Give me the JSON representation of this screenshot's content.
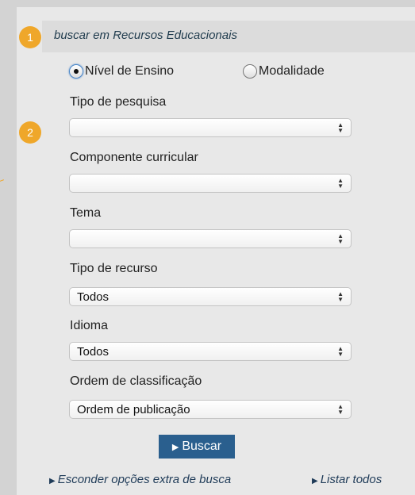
{
  "header": {
    "title": "buscar em Recursos Educacionais"
  },
  "markers": [
    "1",
    "2"
  ],
  "search_mode": {
    "options": [
      {
        "label": "Nível de Ensino",
        "checked": true
      },
      {
        "label": "Modalidade",
        "checked": false
      }
    ]
  },
  "fields": [
    {
      "label": "Tipo de pesquisa",
      "value": ""
    },
    {
      "label": "Componente curricular",
      "value": ""
    },
    {
      "label": "Tema",
      "value": ""
    },
    {
      "label": "Tipo de recurso",
      "value": "Todos"
    },
    {
      "label": "Idioma",
      "value": "Todos"
    },
    {
      "label": "Ordem de classificação",
      "value": "Ordem de publicação"
    }
  ],
  "actions": {
    "search_button": "Buscar",
    "hide_options_link": "Esconder opções extra de busca",
    "list_all_link": "Listar todos"
  },
  "icons": {
    "select_arrows": "updown-chevron-icon",
    "play_triangle": "play-triangle-icon"
  },
  "colors": {
    "accent_marker": "#efa72a",
    "button_bg": "#2a5f8e",
    "panel_bg": "#e8e8e8",
    "outer_bg": "#d3d3d3"
  }
}
